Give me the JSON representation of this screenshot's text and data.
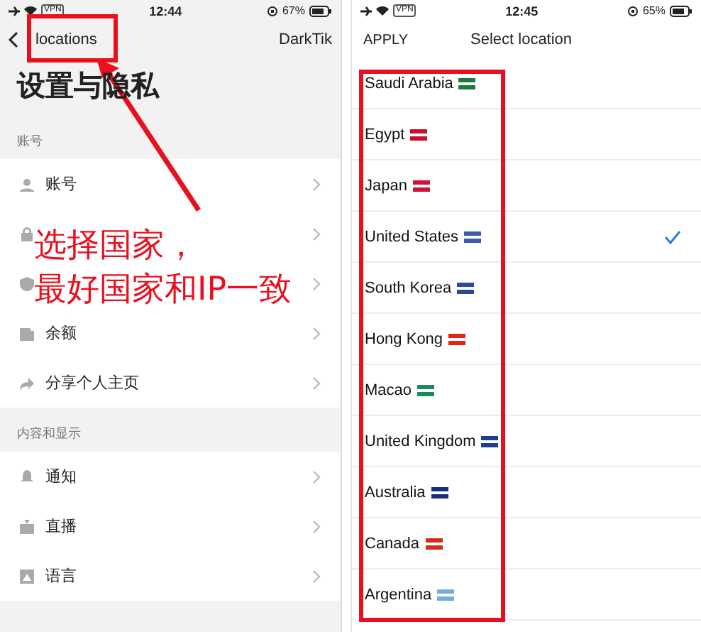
{
  "left_screen": {
    "status_bar": {
      "vpn": "VPN",
      "time": "12:44",
      "battery": "67%"
    },
    "nav": {
      "back": "locations",
      "right": "DarkTik"
    },
    "title": "设置与隐私",
    "sections": [
      {
        "header": "账号",
        "items": [
          {
            "kind": "account",
            "label": "账号"
          },
          {
            "kind": "privacy"
          },
          {
            "kind": "security"
          },
          {
            "kind": "balance",
            "label": "余额"
          },
          {
            "kind": "share",
            "label": "分享个人主页"
          }
        ]
      },
      {
        "header": "内容和显示",
        "items": [
          {
            "kind": "notifications",
            "label": "通知"
          },
          {
            "kind": "live",
            "label": "直播"
          },
          {
            "kind": "language",
            "label": "语言"
          }
        ]
      }
    ]
  },
  "right_screen": {
    "status_bar": {
      "vpn": "VPN",
      "time": "12:45",
      "battery": "65%"
    },
    "apply": "APPLY",
    "title": "Select location",
    "countries": [
      {
        "name": "Saudi Arabia",
        "color": "#1f7a3c",
        "selected": false
      },
      {
        "name": "Egypt",
        "color": "#c8102e",
        "selected": false
      },
      {
        "name": "Japan",
        "color": "#d0103a",
        "selected": false
      },
      {
        "name": "United States",
        "color": "#3c5ba8",
        "selected": true
      },
      {
        "name": "South Korea",
        "color": "#2a4a9a",
        "selected": false
      },
      {
        "name": "Hong Kong",
        "color": "#de2910",
        "selected": false
      },
      {
        "name": "Macao",
        "color": "#1a8a5a",
        "selected": false
      },
      {
        "name": "United Kingdom",
        "color": "#1f3f8a",
        "selected": false
      },
      {
        "name": "Australia",
        "color": "#1a2e7a",
        "selected": false
      },
      {
        "name": "Canada",
        "color": "#d52b1e",
        "selected": false
      },
      {
        "name": "Argentina",
        "color": "#74acdf",
        "selected": false
      }
    ]
  },
  "annotation": {
    "lines": [
      "选择国家，",
      "最好国家和IP一致"
    ]
  }
}
